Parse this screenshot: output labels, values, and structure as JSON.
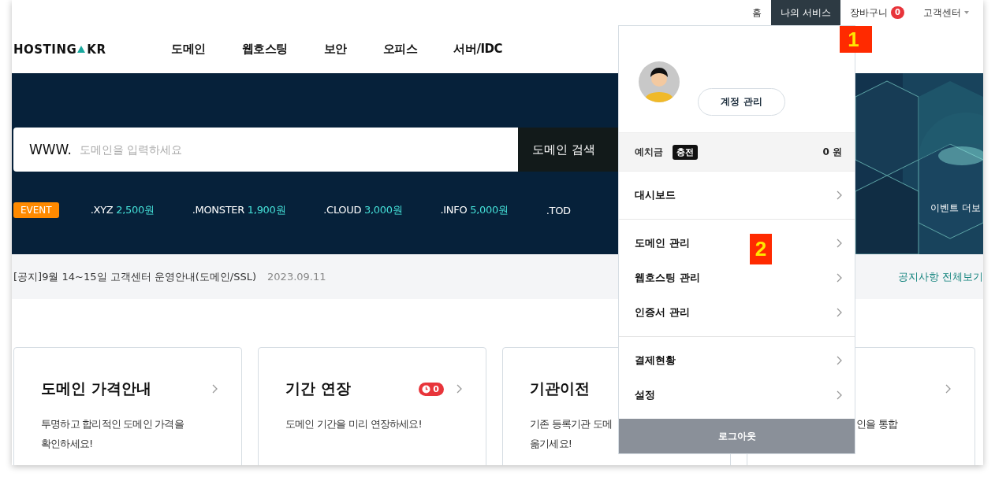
{
  "top_links": [
    {
      "label": "홈",
      "selected": false
    },
    {
      "label": "나의 서비스",
      "selected": true
    },
    {
      "label": "장바구니",
      "selected": false,
      "count": "0"
    },
    {
      "label": "고객센터",
      "selected": false,
      "caret": true
    }
  ],
  "logo": {
    "left": "HOSTING",
    "right": "KR"
  },
  "nav": [
    "도메인",
    "웹호스팅",
    "보안",
    "오피스",
    "서버/IDC"
  ],
  "search": {
    "prefix": "WWW.",
    "placeholder": "도메인을 입력하세요",
    "button": "도메인 검색"
  },
  "event": {
    "badge": "EVENT",
    "items": [
      {
        "tld": ".XYZ",
        "price": "2,500원"
      },
      {
        "tld": ".MONSTER",
        "price": "1,900원"
      },
      {
        "tld": ".CLOUD",
        "price": "3,000원"
      },
      {
        "tld": ".INFO",
        "price": "5,000원"
      },
      {
        "tld": ".TOD"
      }
    ]
  },
  "banner": {
    "kind": "picture",
    "link": "이벤트 더보"
  },
  "notice": {
    "text": "[공지]9월 14~15일 고객센터 운영안내(도메인/SSL)",
    "date": "2023.09.11",
    "more": "공지사항 전체보기"
  },
  "cards": [
    {
      "title": "도메인 가격안내",
      "arrow": true,
      "desc": [
        "투명하고 합리적인 도메인 가격을",
        "확인하세요!"
      ]
    },
    {
      "title": "기간 연장",
      "badge": "0",
      "arrow": true,
      "desc": [
        "도메인 기간을 미리 연장하세요!"
      ]
    },
    {
      "title": "기관이전",
      "desc": [
        "기존 등록기관 도메",
        "옮기세요!"
      ]
    },
    {
      "arrow": true,
      "desc": [
        "인을 통합"
      ]
    }
  ],
  "account_menu": {
    "manage_button": "계정 관리",
    "deposit": {
      "label": "예치금",
      "charge": "충전",
      "amount": "0 원"
    },
    "groups": [
      [
        "대시보드"
      ],
      [
        "도메인 관리",
        "웹호스팅 관리",
        "인증서 관리"
      ],
      [
        "결제현황",
        "설정"
      ]
    ],
    "logout": "로그아웃"
  },
  "callouts": [
    {
      "label": "1",
      "kind": "top"
    },
    {
      "label": "2",
      "kind": "menu"
    }
  ]
}
